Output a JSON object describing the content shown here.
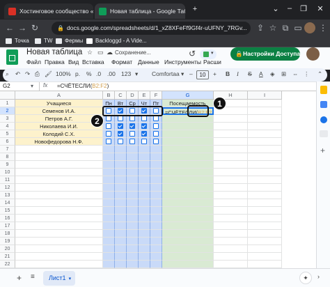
{
  "browser": {
    "tabs": [
      {
        "title": "Хостинговое сообщество «Tim",
        "favicon_color": "#d93025"
      },
      {
        "title": "Новая таблица - Google Табли",
        "favicon_color": "#0f9d58"
      }
    ],
    "new_tab": "+",
    "url": "docs.google.com/spreadsheets/d/1_xZ8XFeFf9Gf4r-uUFNY_7RGv...",
    "bookmarks": [
      "Точка",
      "TW",
      "Фермы",
      "Backloggd - A Vide..."
    ]
  },
  "sheets": {
    "doc_title": "Новая таблица",
    "save_status": "Сохранение...",
    "share_button": "Настройки Доступа",
    "menus": [
      "Файл",
      "Правка",
      "Вид",
      "Вставка",
      "Формат",
      "Данные",
      "Инструменты",
      "Расши"
    ],
    "toolbar": {
      "zoom": "100%",
      "currency": "р.",
      "percent": "%",
      "decimals": ".0",
      "decimals_more": ".00",
      "number_format": "123",
      "font": "Comfortaa",
      "font_size": "10",
      "bold": "B",
      "italic": "I"
    },
    "cell_ref": "G2",
    "formula": "=СЧЁТЕСЛИ(B2:F2)",
    "formula_prefix": "=СЧЁТЕСЛИ(",
    "formula_range": "B2:F2",
    "formula_suffix": ")",
    "columns": [
      "A",
      "B",
      "C",
      "D",
      "E",
      "F",
      "G",
      "H",
      "I"
    ],
    "row_numbers": [
      "1",
      "2",
      "3",
      "4",
      "5",
      "6",
      "7",
      "8",
      "9",
      "10",
      "11",
      "12",
      "13",
      "14",
      "15",
      "16",
      "17",
      "18",
      "19",
      "20",
      "21",
      "22"
    ],
    "header_row": {
      "students": "Учащиеся",
      "days": [
        "Пн",
        "Вт",
        "Ср",
        "Чт",
        "Пт"
      ],
      "attendance": "Посещаемость"
    },
    "students": [
      {
        "name": "Семенов И.А.",
        "checks": [
          false,
          true,
          false,
          true,
          false
        ]
      },
      {
        "name": "Петров А.Г.",
        "checks": [
          false,
          false,
          false,
          false,
          false
        ]
      },
      {
        "name": "Николаева И.И.",
        "checks": [
          false,
          true,
          true,
          true,
          false
        ]
      },
      {
        "name": "Колодий С.Х.",
        "checks": [
          false,
          true,
          false,
          true,
          false
        ]
      },
      {
        "name": "Новофедорова Н.Ф.",
        "checks": [
          false,
          false,
          false,
          false,
          false
        ]
      }
    ],
    "g2_edit_prefix": "=СЧЁТЕСЛИ(",
    "g2_edit_range": "B2:F2",
    "sheet_tab": "Лист1",
    "add_sheet": "+",
    "callouts": [
      "1",
      "2"
    ],
    "colors": {
      "student_fill": "#fdf2cc",
      "days_fill": "#c9daf8",
      "attendance_fill": "#d9ead3",
      "accent": "#0b8043",
      "range": "#d2a04f"
    }
  }
}
